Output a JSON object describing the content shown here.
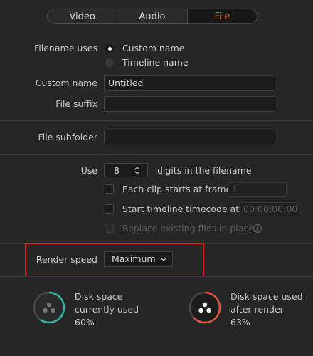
{
  "tabs": [
    {
      "label": "Video",
      "active": false
    },
    {
      "label": "Audio",
      "active": false
    },
    {
      "label": "File",
      "active": true
    }
  ],
  "filename_uses": {
    "label": "Filename uses",
    "options": [
      {
        "label": "Custom name",
        "selected": true
      },
      {
        "label": "Timeline name",
        "selected": false
      }
    ]
  },
  "custom_name": {
    "label": "Custom name",
    "value": "Untitled"
  },
  "file_suffix": {
    "label": "File suffix",
    "value": ""
  },
  "file_subfolder": {
    "label": "File subfolder",
    "value": ""
  },
  "use_digits": {
    "label": "Use",
    "value": "8",
    "suffix": "digits in the filename"
  },
  "each_clip": {
    "label": "Each clip starts at frame",
    "value": "1",
    "checked": false
  },
  "start_timecode": {
    "label": "Start timeline timecode at",
    "value": "00:00:00:00",
    "checked": false
  },
  "replace_files": {
    "label": "Replace existing files in place",
    "checked": false,
    "disabled": true
  },
  "render_speed": {
    "label": "Render speed",
    "value": "Maximum"
  },
  "disk_current": {
    "line1": "Disk space",
    "line2": "currently used",
    "percent": "60%",
    "fraction": 0.6,
    "ring_color": "#2fb7a8"
  },
  "disk_after": {
    "line1": "Disk space used",
    "line2": "after render",
    "percent": "63%",
    "fraction": 0.63,
    "ring_color": "#e0533f"
  }
}
